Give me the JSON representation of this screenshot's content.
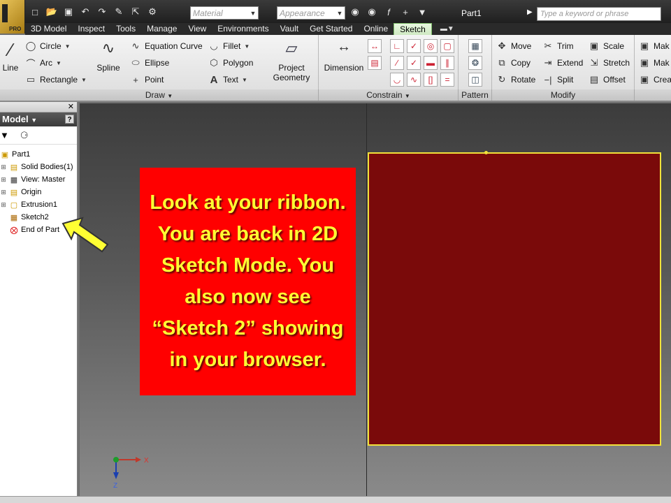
{
  "titlebar": {
    "material_placeholder": "Material",
    "appearance_placeholder": "Appearance",
    "doc_title": "Part1",
    "search_placeholder": "Type a keyword or phrase",
    "logo_badge": "PRO"
  },
  "tabs": [
    {
      "label": "3D Model"
    },
    {
      "label": "Inspect"
    },
    {
      "label": "Tools"
    },
    {
      "label": "Manage"
    },
    {
      "label": "View"
    },
    {
      "label": "Environments"
    },
    {
      "label": "Vault"
    },
    {
      "label": "Get Started"
    },
    {
      "label": "Online"
    },
    {
      "label": "Sketch",
      "active": true
    }
  ],
  "ribbon": {
    "draw": {
      "label": "Draw",
      "line": "Line",
      "circle": "Circle",
      "arc": "Arc",
      "rectangle": "Rectangle",
      "spline": "Spline",
      "equation_curve": "Equation Curve",
      "ellipse": "Ellipse",
      "point": "Point",
      "fillet": "Fillet",
      "polygon": "Polygon",
      "text": "Text",
      "project_geometry_1": "Project",
      "project_geometry_2": "Geometry"
    },
    "constrain": {
      "label": "Constrain",
      "dimension": "Dimension"
    },
    "pattern": {
      "label": "Pattern"
    },
    "modify": {
      "label": "Modify",
      "move": "Move",
      "copy": "Copy",
      "rotate": "Rotate",
      "trim": "Trim",
      "extend": "Extend",
      "split": "Split",
      "scale": "Scale",
      "stretch": "Stretch",
      "offset": "Offset"
    },
    "insert": {
      "mak1": "Mak",
      "mak2": "Mak",
      "crea": "Crea"
    }
  },
  "browser": {
    "title": "Model",
    "items": [
      {
        "label": "Part1"
      },
      {
        "label": "Solid Bodies(1)"
      },
      {
        "label": "View: Master"
      },
      {
        "label": "Origin"
      },
      {
        "label": "Extrusion1"
      },
      {
        "label": "Sketch2"
      },
      {
        "label": "End of Part"
      }
    ]
  },
  "callout": {
    "text": "Look at your ribbon.  You are back in 2D Sketch Mode.  You also now see “Sketch 2” showing in your browser."
  },
  "axis": {
    "x_label": "X",
    "z_label": "Z"
  },
  "colors": {
    "callout_bg": "#ff0000",
    "callout_text": "#ffff33",
    "part_face": "#7a0a0a",
    "part_edge": "#f2e23a",
    "active_tab": "#cfe9c2"
  }
}
